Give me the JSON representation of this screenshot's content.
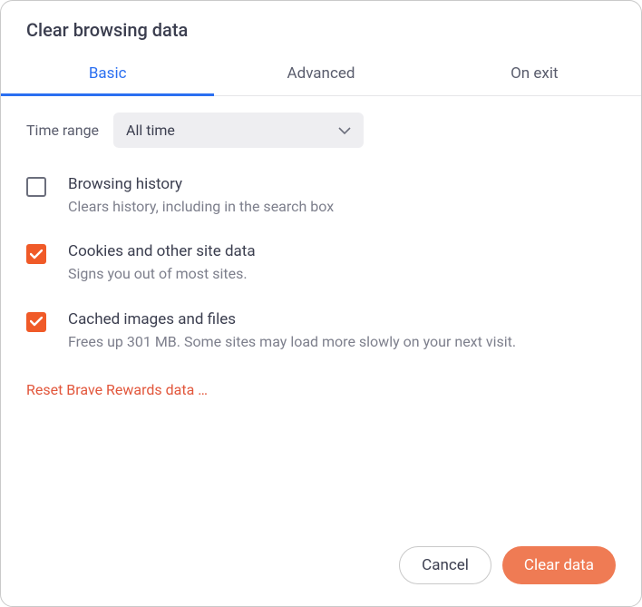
{
  "dialog": {
    "title": "Clear browsing data"
  },
  "tabs": {
    "basic": "Basic",
    "advanced": "Advanced",
    "onexit": "On exit"
  },
  "timeRange": {
    "label": "Time range",
    "value": "All time"
  },
  "options": [
    {
      "title": "Browsing history",
      "desc": "Clears history, including in the search box",
      "checked": false
    },
    {
      "title": "Cookies and other site data",
      "desc": "Signs you out of most sites.",
      "checked": true
    },
    {
      "title": "Cached images and files",
      "desc": "Frees up 301 MB. Some sites may load more slowly on your next visit.",
      "checked": true
    }
  ],
  "resetLink": "Reset Brave Rewards data …",
  "buttons": {
    "cancel": "Cancel",
    "clear": "Clear data"
  },
  "colors": {
    "accent": "#2a6ff1",
    "brand": "#f05a28",
    "primaryButton": "#ef7b54"
  }
}
